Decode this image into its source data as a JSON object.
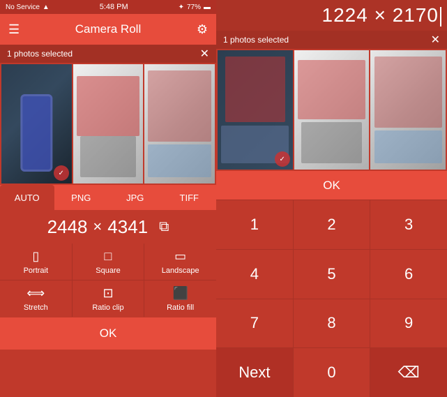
{
  "left": {
    "status": {
      "carrier": "No Service",
      "wifi": "wifi",
      "time": "5:48 PM",
      "bluetooth": "bluetooth",
      "battery": "77%"
    },
    "header": {
      "title": "Camera Roll",
      "menu_label": "☰",
      "gear_label": "⚙"
    },
    "photos_bar": {
      "text": "1 photos selected",
      "close": "✕"
    },
    "format_tabs": [
      "AUTO",
      "PNG",
      "JPG",
      "TIFF"
    ],
    "active_tab": "AUTO",
    "dimensions": {
      "width": "2448",
      "x": "×",
      "height": "4341"
    },
    "layout_buttons": [
      {
        "id": "portrait",
        "label": "Portrait",
        "icon": "▯"
      },
      {
        "id": "square",
        "label": "Square",
        "icon": "□"
      },
      {
        "id": "landscape",
        "label": "Landscape",
        "icon": "▭"
      },
      {
        "id": "stretch",
        "label": "Stretch",
        "icon": "⟺"
      },
      {
        "id": "ratio-clip",
        "label": "Ratio clip",
        "icon": "⊡"
      },
      {
        "id": "ratio-fill",
        "label": "Ratio fill",
        "icon": "⬛"
      }
    ],
    "ok_label": "OK"
  },
  "right": {
    "dimension_display": "1224 × 2170",
    "photos_bar": {
      "text": "1 photos selected",
      "close": "✕"
    },
    "numpad": {
      "ok_label": "OK",
      "keys": [
        "1",
        "2",
        "3",
        "4",
        "5",
        "6",
        "7",
        "8",
        "9",
        "Next",
        "0",
        "⌫"
      ]
    }
  }
}
